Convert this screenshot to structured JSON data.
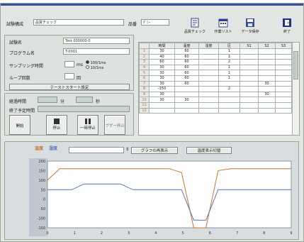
{
  "colors": {
    "title_bar": "#3a4e9e",
    "panel_bg": "#e2e6e2",
    "chart_bg": "#ffffff",
    "axis_bg": "#bfc8d0",
    "series_1": "#c8742e",
    "series_2": "#5a74b8",
    "row_number": "#d06a32"
  },
  "header": {
    "label_1": "試験構成",
    "value_1": "品質チェック",
    "label_2": "品番",
    "value_2": "ﾀﾞﾐｰ"
  },
  "toolbar": [
    {
      "label": "品質チェック",
      "icon": "document-icon"
    },
    {
      "label": "作業リスト",
      "icon": "calendar-icon"
    },
    {
      "label": "データ保存",
      "icon": "save-data-icon"
    },
    {
      "label": "終了",
      "icon": "exit-door-icon"
    }
  ],
  "form": {
    "row1_label": "試験名",
    "row1_value": "Test 000000-0",
    "row2_label": "プログラム名",
    "row2_value": "T-0001",
    "row3_label": "サンプリング時間",
    "row3_unit": "ms",
    "row3_option_a": "100/1ms",
    "row3_option_b": "10/1ms",
    "row4_label": "ループ回数",
    "row4_unit": "回",
    "start_button": "テーストスタート設定"
  },
  "status": {
    "time_label": "経過時間",
    "time_sep1": "分",
    "time_sep2": "秒",
    "state_label": "終了予定時間",
    "buttons": [
      "開始",
      "停止",
      "一時停止",
      "ブザー停止"
    ]
  },
  "grid": {
    "headers": [
      "",
      "時間",
      "温度",
      "湿度",
      "区",
      "S1",
      "S2",
      "S3"
    ],
    "rows": [
      [
        "1",
        "30",
        "60",
        "",
        "1",
        "",
        "",
        ""
      ],
      [
        "2",
        "40",
        "60",
        "",
        "1",
        "",
        "",
        ""
      ],
      [
        "3",
        "60",
        "60",
        "",
        "2",
        "",
        "",
        ""
      ],
      [
        "4",
        "30",
        "60",
        "",
        "1",
        "",
        "",
        ""
      ],
      [
        "5",
        "30",
        "60",
        "",
        "1",
        "",
        "",
        ""
      ],
      [
        "6",
        "30",
        "60",
        "",
        "1",
        "",
        "",
        ""
      ],
      [
        "7",
        "30",
        "60",
        "",
        "",
        "",
        "30",
        ""
      ],
      [
        "8",
        "-150",
        "",
        "",
        "2",
        "",
        "",
        ""
      ],
      [
        "9",
        "30",
        "",
        "",
        "",
        "",
        "30",
        ""
      ],
      [
        "10",
        "30",
        "30",
        "",
        "",
        "",
        "",
        ""
      ],
      [
        "11",
        "",
        "",
        "",
        "",
        "",
        "",
        ""
      ],
      [
        "12",
        "",
        "",
        "",
        "",
        "",
        "",
        ""
      ]
    ]
  },
  "chart_controls": {
    "legend_1": "温度",
    "legend_2": "湿度",
    "button_1": "グラフの再表示",
    "button_2": "温度表示切替"
  },
  "chart_data": {
    "type": "line",
    "x": [
      0,
      1,
      2,
      3,
      4,
      5,
      6,
      7,
      8,
      9,
      10,
      11,
      12,
      13,
      14,
      15,
      16,
      17,
      18,
      19,
      20
    ],
    "series": [
      {
        "values": [
          100,
          160,
          160,
          160,
          160,
          160,
          160,
          160,
          160,
          160,
          160,
          140,
          -150,
          -150,
          150,
          160,
          160,
          160,
          160,
          160,
          160
        ]
      },
      {
        "values": [
          50,
          50,
          50,
          80,
          80,
          80,
          80,
          50,
          50,
          50,
          50,
          50,
          -110,
          -110,
          50,
          50,
          50,
          50,
          50,
          50,
          50
        ]
      }
    ],
    "ylim": [
      -150,
      200
    ],
    "xlim": [
      0,
      20
    ],
    "y_ticks": [
      "200",
      "150",
      "100",
      "50",
      "0",
      "-50",
      "-100",
      "-150"
    ],
    "x_ticks": [
      "0",
      "1",
      "2",
      "3",
      "4",
      "5",
      "6",
      "7",
      "8",
      "9"
    ],
    "grid": false
  }
}
